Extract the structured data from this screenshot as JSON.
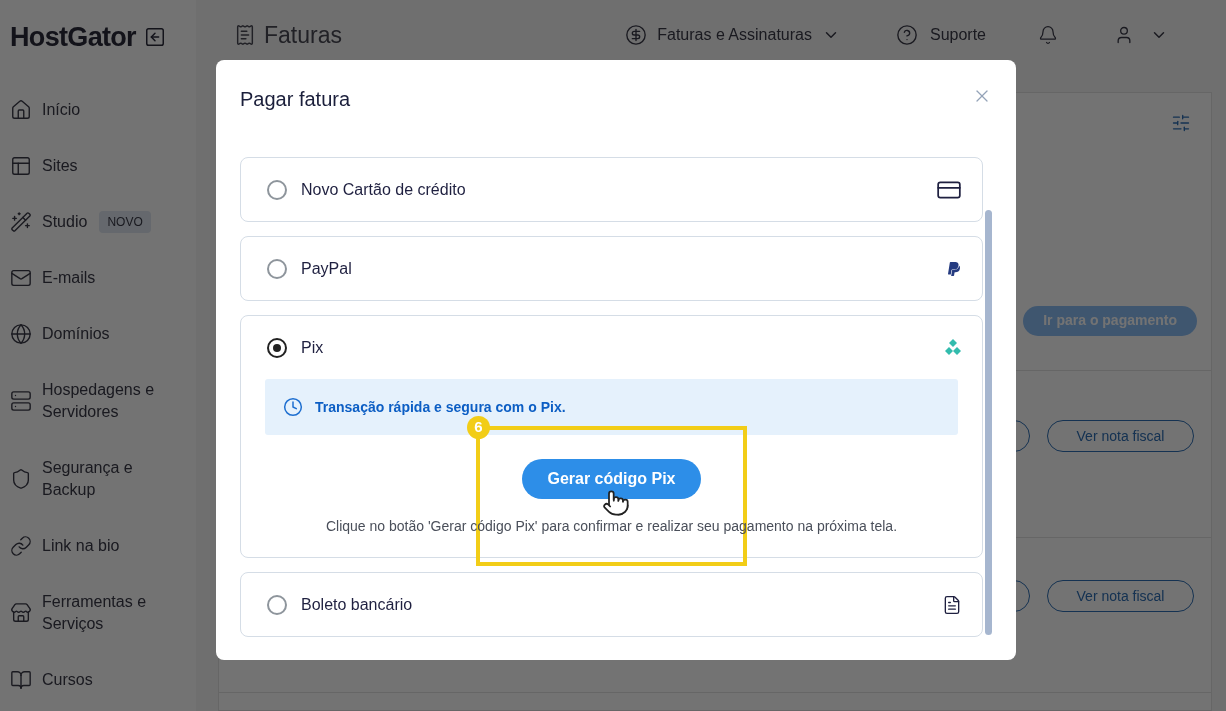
{
  "sidebar": {
    "logo": "HostGator",
    "items": [
      {
        "label": "Início"
      },
      {
        "label": "Sites"
      },
      {
        "label": "Studio",
        "badge": "NOVO"
      },
      {
        "label": "E-mails"
      },
      {
        "label": "Domínios"
      },
      {
        "label": "Hospedagens e Servidores"
      },
      {
        "label": "Segurança e Backup"
      },
      {
        "label": "Link na bio"
      },
      {
        "label": "Ferramentas e Serviços"
      },
      {
        "label": "Cursos"
      }
    ]
  },
  "header": {
    "title": "Faturas",
    "menu": "Faturas e Assinaturas",
    "support": "Suporte"
  },
  "invoices": {
    "pay_button": "Ir para o pagamento",
    "rows": [
      {
        "button": "Ver nota fiscal"
      },
      {
        "button": "Ver nota fiscal"
      }
    ]
  },
  "modal": {
    "title": "Pagar fatura",
    "options": [
      {
        "label": "Novo Cartão de crédito",
        "kind": "card",
        "selected": false
      },
      {
        "label": "PayPal",
        "kind": "paypal",
        "selected": false
      },
      {
        "label": "Pix",
        "kind": "pix",
        "selected": true,
        "notice": "Transação rápida e segura com o Pix.",
        "button": "Gerar código Pix",
        "hint": "Clique no botão 'Gerar código Pix' para confirmar e realizar seu pagamento na próxima tela."
      },
      {
        "label": "Boleto bancário",
        "kind": "boleto",
        "selected": false
      }
    ]
  },
  "annotation": {
    "step": "6"
  }
}
